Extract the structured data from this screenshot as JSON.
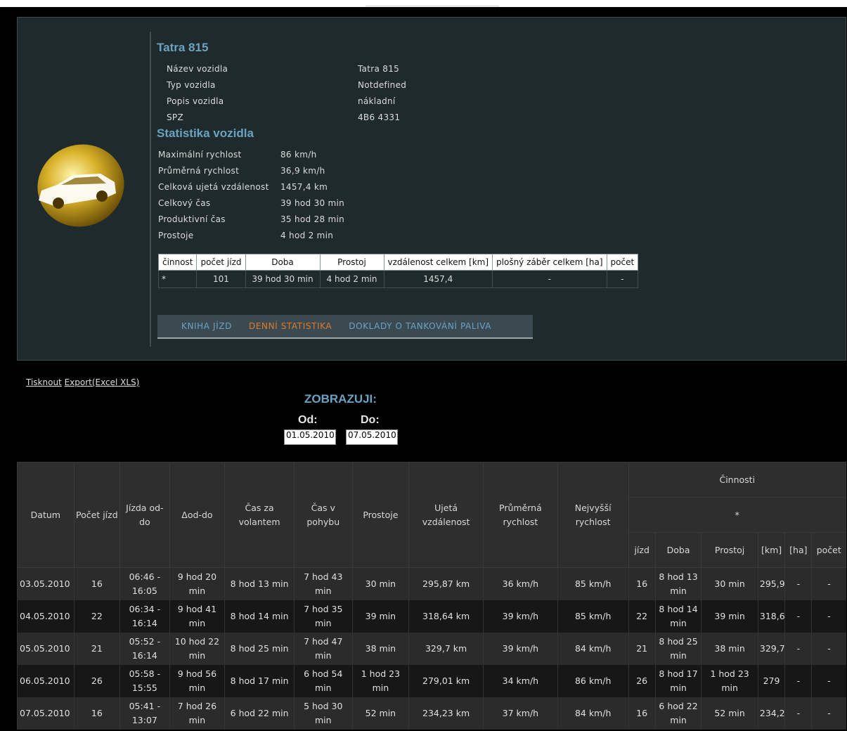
{
  "vehicle": {
    "title": "Tatra 815",
    "fields": [
      {
        "label": "Název vozidla",
        "value": "Tatra 815"
      },
      {
        "label": "Typ vozidla",
        "value": "Notdefined"
      },
      {
        "label": "Popis vozidla",
        "value": "nákladní"
      },
      {
        "label": "SPZ",
        "value": "4B6 4331"
      }
    ]
  },
  "stats": {
    "title": "Statistika vozidla",
    "rows": [
      {
        "label": "Maximální rychlost",
        "value": "86 km/h"
      },
      {
        "label": "Průměrná rychlost",
        "value": "36,9 km/h"
      },
      {
        "label": "Celková ujetá vzdálenost",
        "value": "1457,4 km"
      },
      {
        "label": "Celkový čas",
        "value": "39 hod 30 min"
      },
      {
        "label": "Produktivní čas",
        "value": "35 hod 28 min"
      },
      {
        "label": "Prostoje",
        "value": "4 hod 2 min"
      }
    ]
  },
  "summary_table": {
    "headers": [
      "činnost",
      "počet jízd",
      "Doba",
      "Prostoj",
      "vzdálenost celkem [km]",
      "plošný záběr celkem [ha]",
      "počet"
    ],
    "row": [
      "*",
      "101",
      "39 hod 30 min",
      "4 hod 2 min",
      "1457,4",
      "-",
      "-"
    ]
  },
  "menu": {
    "items": [
      "KNIHA JÍZD",
      "DENNÍ STATISTIKA",
      "DOKLADY O TANKOVÁNÍ PALIVA"
    ],
    "active_color": "#e07a2a",
    "link_color": "#6aa3c2"
  },
  "links": {
    "print": "Tisknout",
    "export": "Export(Excel XLS)"
  },
  "filter": {
    "title": "ZOBRAZUJI:",
    "from_label": "Od:",
    "to_label": "Do:",
    "from_value": "01.05.2010",
    "to_value": "07.05.2010"
  },
  "main_table": {
    "headers": [
      "Datum",
      "Počet jízd",
      "Jízda od-do",
      "Δod-do",
      "Čas za volantem",
      "Čas v pohybu",
      "Prostoje",
      "Ujetá vzdálenost",
      "Průměrná rychlost",
      "Nejvyšší rychlost"
    ],
    "group": "Činnosti",
    "subgroup": "*",
    "subheaders": [
      "jízd",
      "Doba",
      "Prostoj",
      "[km]",
      "[ha]",
      "počet"
    ],
    "rows": [
      [
        "03.05.2010",
        "16",
        "06:46 - 16:05",
        "9 hod 20 min",
        "8 hod 13 min",
        "7 hod 43 min",
        "30 min",
        "295,87 km",
        "36 km/h",
        "85 km/h",
        "16",
        "8 hod 13 min",
        "30 min",
        "295,9",
        "-",
        "-"
      ],
      [
        "04.05.2010",
        "22",
        "06:34 - 16:14",
        "9 hod 41 min",
        "8 hod 14 min",
        "7 hod 35 min",
        "39 min",
        "318,64 km",
        "39 km/h",
        "85 km/h",
        "22",
        "8 hod 14 min",
        "39 min",
        "318,6",
        "-",
        "-"
      ],
      [
        "05.05.2010",
        "21",
        "05:52 - 16:14",
        "10 hod 22 min",
        "8 hod 25 min",
        "7 hod 47 min",
        "38 min",
        "329,7 km",
        "39 km/h",
        "84 km/h",
        "21",
        "8 hod 25 min",
        "38 min",
        "329,7",
        "-",
        "-"
      ],
      [
        "06.05.2010",
        "26",
        "05:58 - 15:55",
        "9 hod 56 min",
        "8 hod 17 min",
        "6 hod 54 min",
        "1 hod 23 min",
        "279,01 km",
        "34 km/h",
        "86 km/h",
        "26",
        "8 hod 17 min",
        "1 hod 23 min",
        "279",
        "-",
        "-"
      ],
      [
        "07.05.2010",
        "16",
        "05:41 - 13:07",
        "7 hod 26 min",
        "6 hod 22 min",
        "5 hod 30 min",
        "52 min",
        "234,23 km",
        "37 km/h",
        "84 km/h",
        "16",
        "6 hod 22 min",
        "52 min",
        "234,2",
        "-",
        "-"
      ]
    ]
  }
}
